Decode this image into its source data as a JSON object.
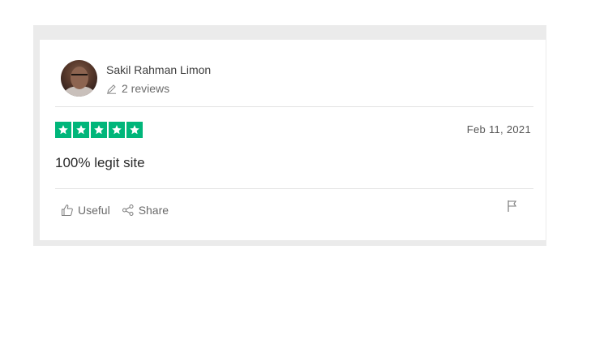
{
  "reviewer": {
    "name": "Sakil Rahman Limon",
    "review_count": "2 reviews"
  },
  "rating": {
    "stars": 5,
    "max_stars": 5,
    "star_color": "#00b67a"
  },
  "review": {
    "date": "Feb 11, 2021",
    "text": "100% legit site"
  },
  "actions": {
    "useful_label": "Useful",
    "share_label": "Share"
  },
  "icons": {
    "review_count_icon": "pencil-icon",
    "useful_icon": "thumbs-up-icon",
    "share_icon": "share-icon",
    "report_icon": "flag-icon"
  }
}
